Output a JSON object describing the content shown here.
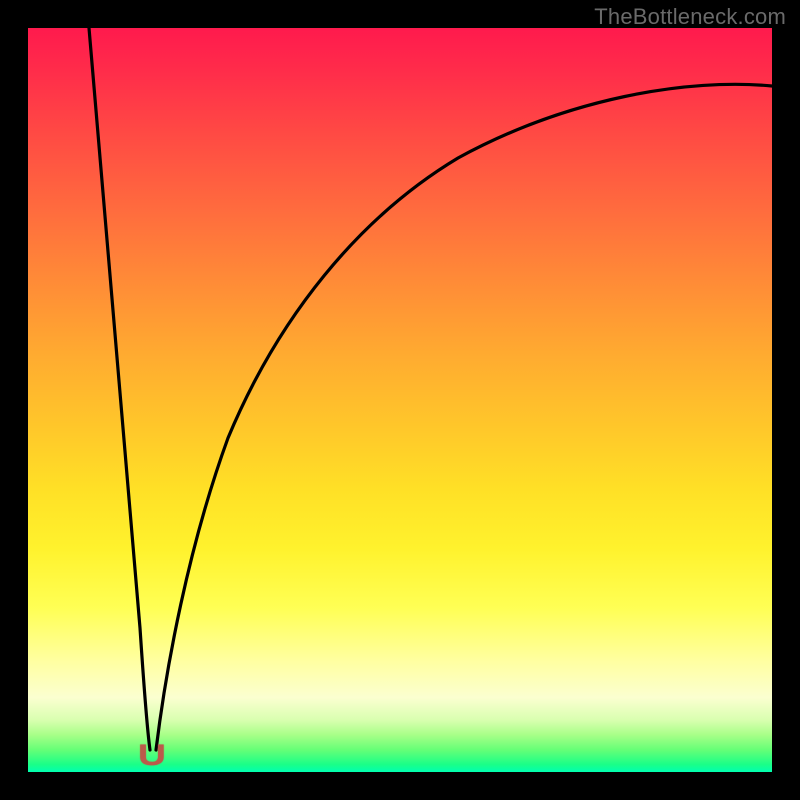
{
  "watermark": "TheBottleneck.com",
  "marker_glyph": "U",
  "chart_data": {
    "type": "line",
    "title": "",
    "xlabel": "",
    "ylabel": "",
    "xlim": [
      0,
      100
    ],
    "ylim": [
      0,
      100
    ],
    "gradient_top_color": "#ff1a4d",
    "gradient_bottom_color": "#00ffb0",
    "series": [
      {
        "name": "left-branch",
        "x": [
          8.2,
          9,
          10,
          11,
          12,
          13,
          14,
          15,
          15.8
        ],
        "values": [
          100,
          89,
          76,
          63,
          50,
          37,
          24,
          12,
          3
        ]
      },
      {
        "name": "right-branch",
        "x": [
          17.7,
          19,
          21,
          24,
          28,
          33,
          39,
          46,
          54,
          63,
          73,
          84,
          96,
          100
        ],
        "values": [
          3,
          12,
          23,
          35,
          46,
          55,
          63,
          70,
          76,
          81,
          85,
          88.5,
          91.5,
          92.2
        ]
      }
    ],
    "marker": {
      "x": 16.7,
      "y": 2.2
    }
  }
}
